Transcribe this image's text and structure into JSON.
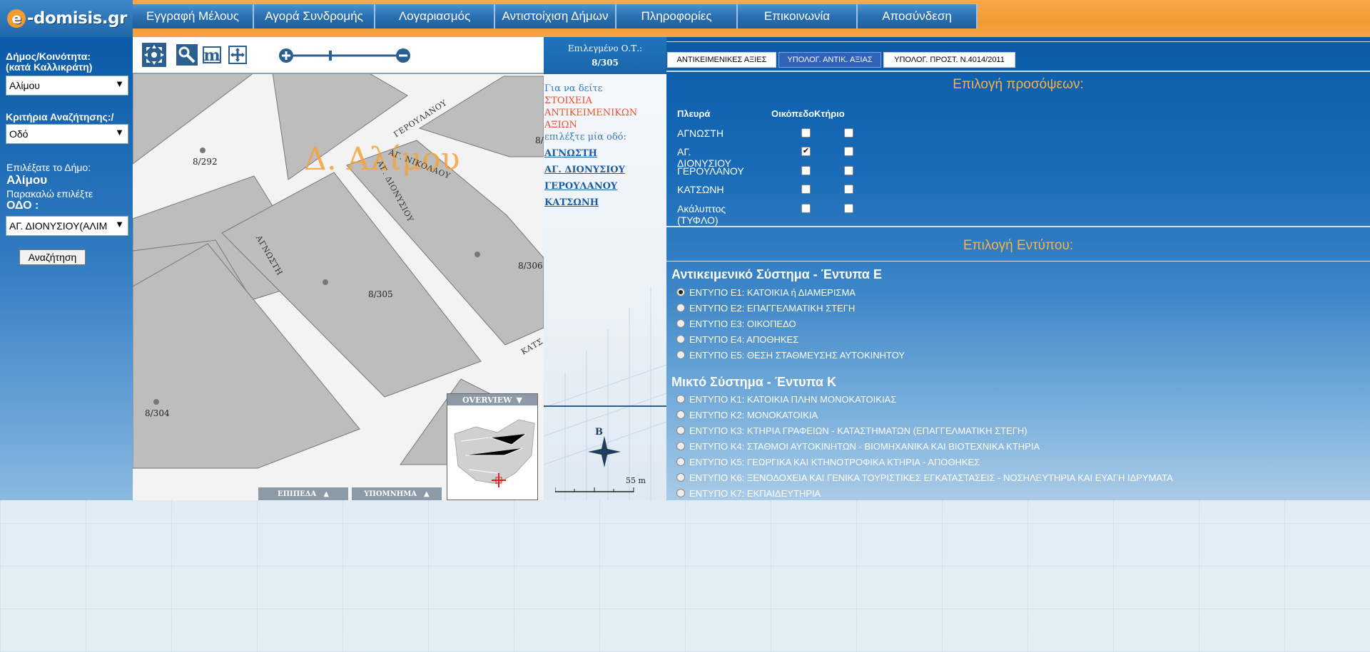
{
  "logo": {
    "text": "-domisis.gr",
    "letter": "e"
  },
  "nav": [
    {
      "label": "Εγγραφή Μέλους",
      "w": 170
    },
    {
      "label": "Αγορά Συνδρομής",
      "w": 170
    },
    {
      "label": "Λογαριασμός",
      "w": 168
    },
    {
      "label": "Αντιστοίχιση Δήμων",
      "w": 170
    },
    {
      "label": "Πληροφορίες",
      "w": 170
    },
    {
      "label": "Επικοινωνία",
      "w": 168
    },
    {
      "label": "Αποσύνδεση",
      "w": 168
    }
  ],
  "sidebar": {
    "municipality_label_1": "Δήμος/Κοινότητα:",
    "municipality_label_2": "(κατά Καλλικράτη)",
    "municipality_value": "Αλίμου",
    "criteria_label": "Κριτήρια Αναζήτησης:/",
    "criteria_value": "Οδό",
    "selected_prefix": "Επιλέξατε το Δήμο:",
    "selected_municipality": "Αλίμου",
    "please_select": "Παρακαλώ επιλέξτε",
    "street_label": "ΟΔΟ :",
    "street_value": "ΑΓ. ΔΙΟΝΥΣΙΟΥ(ΑΛΙΜ",
    "search_button": "Αναζήτηση"
  },
  "map": {
    "municipality_overlay": "Δ. Αλίμου",
    "block_labels": [
      "8/292",
      "8/305",
      "8/306",
      "8/304",
      "8/"
    ],
    "streets": [
      "ΓΕΡΟΥΛΑΝΟΥ",
      "ΑΓ. ΝΙΚΟΛΑΟΥ",
      "ΑΓ. ΔΙΟΝΥΣΙΟΥ",
      "ΑΓΝΩΣΤΗ",
      "ΚΑΤΣ"
    ],
    "overview_label": "OVERVIEW",
    "layers_tab": "ΕΠΙΠΕΔΑ",
    "legend_tab": "ΥΠΟΜΝΗΜΑ",
    "compass_letter": "B",
    "scale_label": "55 m"
  },
  "block_panel": {
    "title": "Επιλεγμένο Ο.Τ.:",
    "value": "8/305",
    "intro": "Για να δείτε",
    "highlight": "ΣΤΟΙΧΕΙΑ ΑΝΤΙΚΕΙΜΕΝΙΚΩΝ ΑΞΙΩΝ",
    "instruction": "επιλέξτε μία οδό:",
    "streets": [
      "ΑΓΝΩΣΤΗ",
      "ΑΓ. ΔΙΟΝΥΣΙΟΥ",
      "ΓΕΡΟΥΛΑΝΟΥ",
      "ΚΑΤΣΩΝΗ"
    ]
  },
  "right_panel": {
    "tabs": [
      "ΑΝΤΙΚΕΙΜΕΝΙΚΕΣ ΑΞΙΕΣ",
      "ΥΠΟΛΟΓ. ΑΝΤΙΚ. ΑΞΙΑΣ",
      "ΥΠΟΛΟΓ. ΠΡΟΣΤ. Ν.4014/2011"
    ],
    "active_tab": 1,
    "facades_title": "Επιλογή προσόψεων:",
    "facade_headers": [
      "Πλευρά",
      "Οικόπεδο",
      "Κτήριο"
    ],
    "facades": [
      {
        "side": "ΑΓΝΩΣΤΗ",
        "plot": false,
        "building": false
      },
      {
        "side": "ΑΓ. ΔΙΟΝΥΣΙΟΥ",
        "plot": true,
        "building": false
      },
      {
        "side": "ΓΕΡΟΥΛΑΝΟΥ",
        "plot": false,
        "building": false
      },
      {
        "side": "ΚΑΤΣΩΝΗ",
        "plot": false,
        "building": false
      },
      {
        "side": "Ακάλυπτος (ΤΥΦΛΟ)",
        "plot": false,
        "building": false
      }
    ],
    "forms_title": "Επιλογή Εντύπου:",
    "group_e_title": "Αντικειμενικό Σύστημα - Έντυπα Ε",
    "forms_e": [
      "ΕΝΤΥΠΟ Ε1: ΚΑΤΟΙΚΙΑ ή ΔΙΑΜΕΡΙΣΜΑ",
      "ΕΝΤΥΠΟ Ε2: ΕΠΑΓΓΕΛΜΑΤΙΚΗ ΣΤΕΓΗ",
      "ΕΝΤΥΠΟ Ε3: ΟΙΚΟΠΕΔΟ",
      "ΕΝΤΥΠΟ Ε4: ΑΠΟΘΗΚΕΣ",
      "ΕΝΤΥΠΟ Ε5: ΘΕΣΗ ΣΤΑΘΜΕΥΣΗΣ ΑΥΤΟΚΙΝΗΤΟΥ"
    ],
    "selected_form_e": 0,
    "group_k_title": "Μικτό Σύστημα - Έντυπα Κ",
    "forms_k": [
      "ΕΝΤΥΠΟ Κ1: ΚΑΤΟΙΚΙΑ ΠΛΗΝ ΜΟΝΟΚΑΤΟΙΚΙΑΣ",
      "ΕΝΤΥΠΟ Κ2: ΜΟΝΟΚΑΤΟΙΚΙΑ",
      "ΕΝΤΥΠΟ Κ3: ΚΤΗΡΙΑ ΓΡΑΦΕΙΩΝ - ΚΑΤΑΣΤΗΜΑΤΩΝ (ΕΠΑΓΓΕΛΜΑΤΙΚΗ ΣΤΕΓΗ)",
      "ΕΝΤΥΠΟ Κ4: ΣΤΑΘΜΟΙ ΑΥΤΟΚΙΝΗΤΩΝ - ΒΙΟΜΗΧΑΝΙΚΑ ΚΑΙ ΒΙΟΤΕΧΝΙΚΑ ΚΤΗΡΙΑ",
      "ΕΝΤΥΠΟ Κ5: ΓΕΩΡΓΙΚΑ ΚΑΙ ΚΤΗΝΟΤΡΟΦΙΚΑ ΚΤΗΡΙΑ - ΑΠΟΘΗΚΕΣ",
      "ΕΝΤΥΠΟ Κ6: ΞΕΝΟΔΟΧΕΙΑ ΚΑΙ ΓΕΝΙΚΑ ΤΟΥΡΙΣΤΙΚΕΣ ΕΓΚΑΤΑΣΤΑΣΕΙΣ - ΝΟΣΗΛΕΥΤΗΡΙΑ ΚΑΙ ΕΥΑΓΗ ΙΔΡΥΜΑΤΑ",
      "ΕΝΤΥΠΟ Κ7: ΕΚΠΑΙΔΕΥΤΗΡΙΑ"
    ]
  },
  "colors": {
    "accent_orange": "#f39a33",
    "header_blue": "#1f67a8",
    "title_orange": "#f7b24a"
  }
}
